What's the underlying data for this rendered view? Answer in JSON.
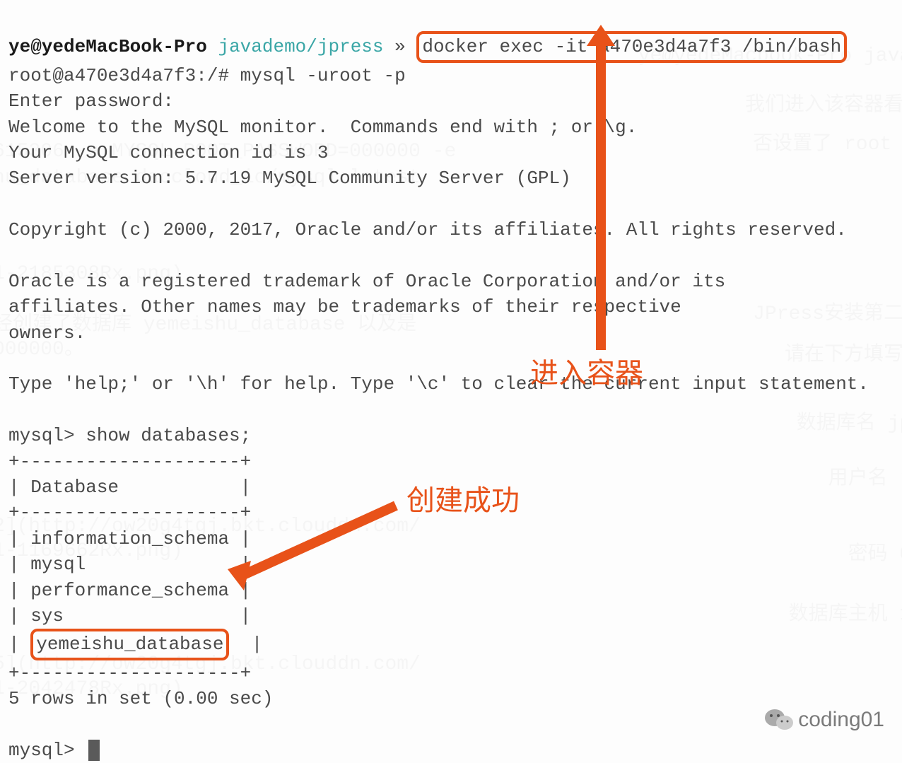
{
  "prompt": {
    "user_host": "ye@yedeMacBook-Pro",
    "path": "javademo/jpress",
    "separator": "»",
    "command": "docker exec -it a470e3d4a7f3 /bin/bash"
  },
  "lines": {
    "l2": "root@a470e3d4a7f3:/# mysql -uroot -p",
    "l3": "Enter password:",
    "l4": "Welcome to the MySQL monitor.  Commands end with ; or \\g.",
    "l5": "Your MySQL connection id is 3",
    "l6": "Server version: 5.7.19 MySQL Community Server (GPL)",
    "l7": "",
    "l8": "Copyright (c) 2000, 2017, Oracle and/or its affiliates. All rights reserved.",
    "l9": "",
    "l10": "Oracle is a registered trademark of Oracle Corporation and/or its",
    "l11": "affiliates. Other names may be trademarks of their respective",
    "l12": "owners.",
    "l13": "",
    "l14": "Type 'help;' or '\\h' for help. Type '\\c' to clear the current input statement.",
    "l15": "",
    "l16": "mysql> show databases;",
    "l17": "+--------------------+",
    "l18": "| Database           |",
    "l19": "+--------------------+",
    "l20": "| information_schema |",
    "l21": "| mysql              |",
    "l22": "| performance_schema |",
    "l23a": "| sys                |",
    "l23b": "|",
    "l24a": "yemeishu_database",
    "l24b": "|",
    "l25": "+--------------------+",
    "l26": "5 rows in set (0.00 sec)",
    "l27": "",
    "l28": "mysql> "
  },
  "annotations": {
    "enter_container": "进入容器",
    "create_success": "创建成功"
  },
  "watermark": {
    "corner": "coding01"
  },
  "colors": {
    "highlight": "#e85219",
    "teal": "#3aa6a6"
  }
}
